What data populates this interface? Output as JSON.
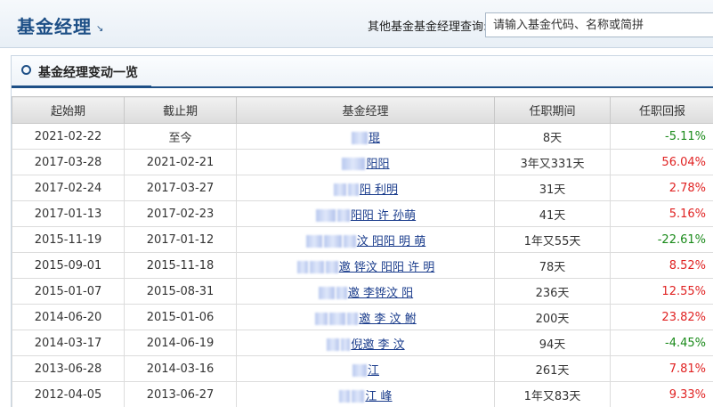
{
  "header": {
    "title": "基金经理",
    "title_arrow": "↘",
    "search_label": "其他基金基金经理查询:",
    "search_placeholder": "请输入基金代码、名称或简拼"
  },
  "section": {
    "title": "基金经理变动一览"
  },
  "table": {
    "columns": [
      "起始期",
      "截止期",
      "基金经理",
      "任职期间",
      "任职回报"
    ],
    "rows": [
      {
        "start": "2021-02-22",
        "end": "至今",
        "manager": "琨",
        "tenure": "8天",
        "return": "-5.11%",
        "sign": "neg"
      },
      {
        "start": "2017-03-28",
        "end": "2021-02-21",
        "manager": "阳阳",
        "tenure": "3年又331天",
        "return": "56.04%",
        "sign": "pos"
      },
      {
        "start": "2017-02-24",
        "end": "2017-03-27",
        "manager": "阳 利明",
        "tenure": "31天",
        "return": "2.78%",
        "sign": "pos"
      },
      {
        "start": "2017-01-13",
        "end": "2017-02-23",
        "manager": "阳阳 许 孙萌",
        "tenure": "41天",
        "return": "5.16%",
        "sign": "pos"
      },
      {
        "start": "2015-11-19",
        "end": "2017-01-12",
        "manager": "汶 阳阳 明 萌",
        "tenure": "1年又55天",
        "return": "-22.61%",
        "sign": "neg"
      },
      {
        "start": "2015-09-01",
        "end": "2015-11-18",
        "manager": "邀 铧汶 阳阳 许 明",
        "tenure": "78天",
        "return": "8.52%",
        "sign": "pos"
      },
      {
        "start": "2015-01-07",
        "end": "2015-08-31",
        "manager": "邀 李铧汶 阳",
        "tenure": "236天",
        "return": "12.55%",
        "sign": "pos"
      },
      {
        "start": "2014-06-20",
        "end": "2015-01-06",
        "manager": "邀 李 汶 鲋",
        "tenure": "200天",
        "return": "23.82%",
        "sign": "pos"
      },
      {
        "start": "2014-03-17",
        "end": "2014-06-19",
        "manager": "倪邀 李 汶",
        "tenure": "94天",
        "return": "-4.45%",
        "sign": "neg"
      },
      {
        "start": "2013-06-28",
        "end": "2014-03-16",
        "manager": "江",
        "tenure": "261天",
        "return": "7.81%",
        "sign": "pos"
      },
      {
        "start": "2012-04-05",
        "end": "2013-06-27",
        "manager": "江 峰",
        "tenure": "1年又83天",
        "return": "9.33%",
        "sign": "pos"
      }
    ]
  },
  "colors": {
    "accent": "#1d4f86",
    "positive": "#e02222",
    "negative": "#1a8a1a",
    "link": "#1a3c8c"
  }
}
